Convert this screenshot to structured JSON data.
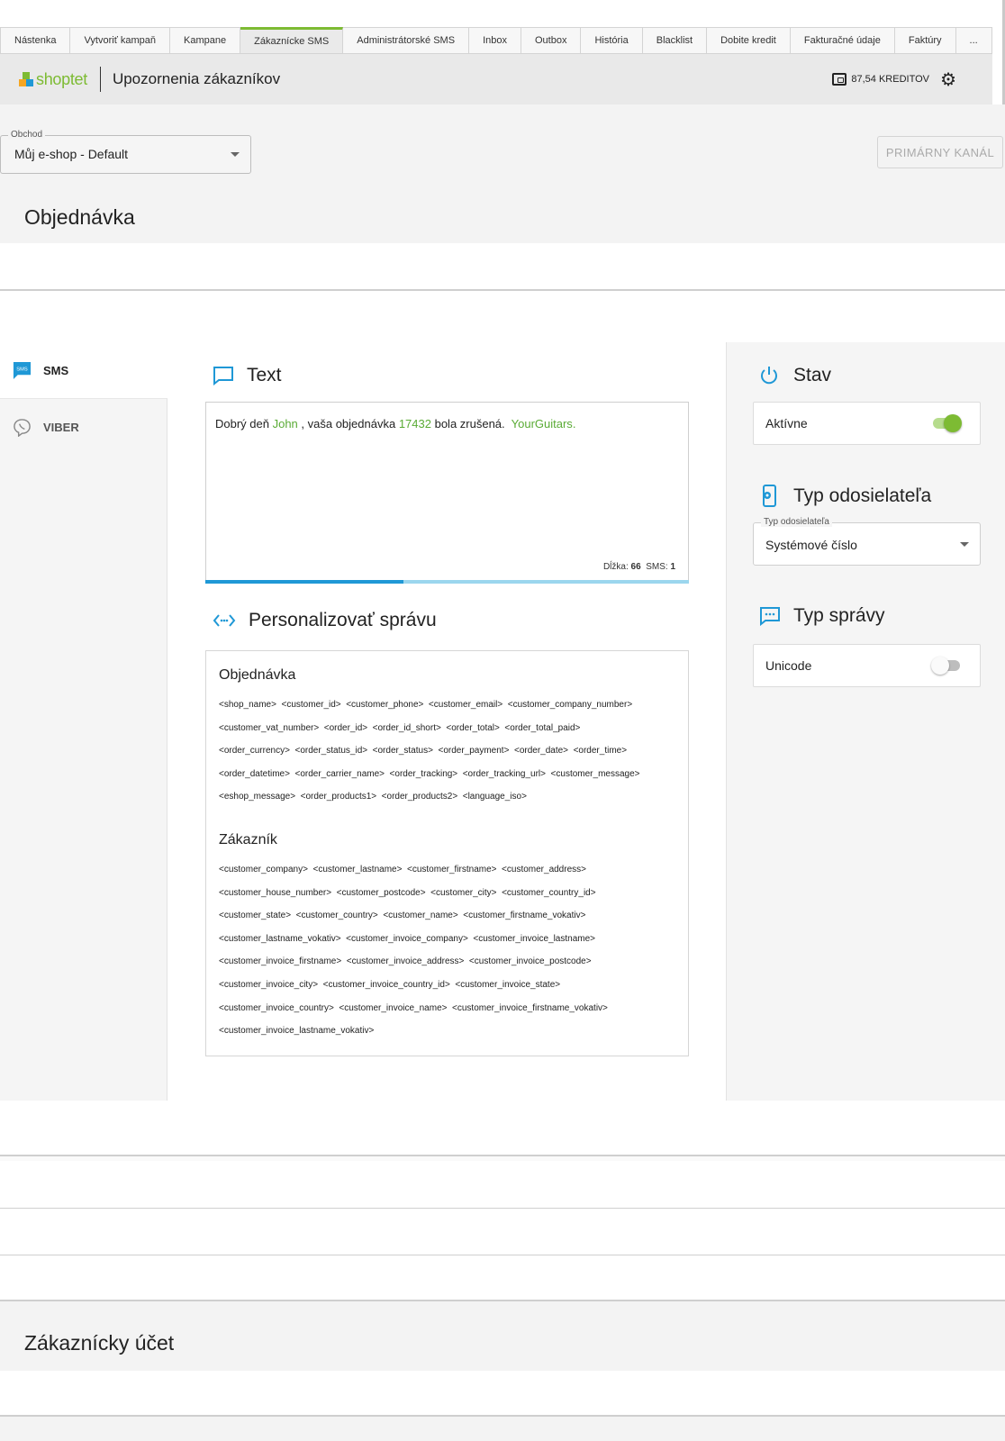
{
  "tabs": [
    {
      "label": "Nástenka",
      "active": false
    },
    {
      "label": "Vytvoriť kampaň",
      "active": false
    },
    {
      "label": "Kampane",
      "active": false
    },
    {
      "label": "Zákaznícke SMS",
      "active": true
    },
    {
      "label": "Administrátorské SMS",
      "active": false
    },
    {
      "label": "Inbox",
      "active": false
    },
    {
      "label": "Outbox",
      "active": false
    },
    {
      "label": "História",
      "active": false
    },
    {
      "label": "Blacklist",
      "active": false
    },
    {
      "label": "Dobite kredit",
      "active": false
    },
    {
      "label": "Fakturačné údaje",
      "active": false
    },
    {
      "label": "Faktúry",
      "active": false
    },
    {
      "label": "...",
      "active": false
    }
  ],
  "header": {
    "logo_text": "shoptet",
    "title": "Upozornenia zákazníkov",
    "credits": "87,54 KREDITOV",
    "settings_icon": "gear-icon"
  },
  "shop_select": {
    "label": "Obchod",
    "value": "Můj e-shop - Default"
  },
  "primary_channel_button": "PRIMÁRNY KANÁL",
  "sections": {
    "order": "Objednávka",
    "customer_account": "Zákaznícky účet"
  },
  "channels": [
    {
      "label": "SMS",
      "icon": "sms-icon",
      "active": true
    },
    {
      "label": "VIBER",
      "icon": "viber-icon",
      "active": false
    }
  ],
  "text_section": {
    "title": "Text",
    "message": [
      {
        "t": "Dobrý deň ",
        "var": false
      },
      {
        "t": "John",
        "var": true
      },
      {
        "t": " , vaša objednávka ",
        "var": false
      },
      {
        "t": "17432",
        "var": true
      },
      {
        "t": " bola zrušená.  ",
        "var": false
      },
      {
        "t": "YourGuitars",
        "var": true
      },
      {
        "t": ".",
        "var": true
      }
    ],
    "length_label": "Dĺžka:",
    "length_value": "66",
    "sms_label": "SMS:",
    "sms_value": "1",
    "progress": 0.41
  },
  "personalize": {
    "title": "Personalizovať správu",
    "groups": [
      {
        "title": "Objednávka",
        "lines": [
          "<shop_name>  <customer_id>  <customer_phone>  <customer_email>  <customer_company_number>",
          "<customer_vat_number>  <order_id>  <order_id_short>  <order_total>  <order_total_paid>",
          "<order_currency>  <order_status_id>  <order_status>  <order_payment>  <order_date>  <order_time>",
          "<order_datetime>  <order_carrier_name>  <order_tracking>  <order_tracking_url>  <customer_message>",
          "<eshop_message>  <order_products1>  <order_products2>  <language_iso>"
        ]
      },
      {
        "title": "Zákazník",
        "lines": [
          "<customer_company>  <customer_lastname>  <customer_firstname>  <customer_address>",
          "<customer_house_number>  <customer_postcode>  <customer_city>  <customer_country_id>",
          "<customer_state>  <customer_country>  <customer_name>  <customer_firstname_vokativ>",
          "<customer_lastname_vokativ>  <customer_invoice_company>  <customer_invoice_lastname>",
          "<customer_invoice_firstname>  <customer_invoice_address>  <customer_invoice_postcode>",
          "<customer_invoice_city>  <customer_invoice_country_id>  <customer_invoice_state>",
          "<customer_invoice_country>  <customer_invoice_name>  <customer_invoice_firstname_vokativ>",
          "<customer_invoice_lastname_vokativ>"
        ]
      }
    ]
  },
  "status": {
    "title": "Stav",
    "label": "Aktívne",
    "on": true
  },
  "sender_type": {
    "title": "Typ odosielateľa",
    "field_label": "Typ odosielateľa",
    "value": "Systémové číslo"
  },
  "message_type": {
    "title": "Typ správy",
    "label": "Unicode",
    "on": false
  },
  "colors": {
    "accent_green": "#7dbb33",
    "accent_blue": "#1f98d6",
    "variable_green": "#5aab35"
  }
}
